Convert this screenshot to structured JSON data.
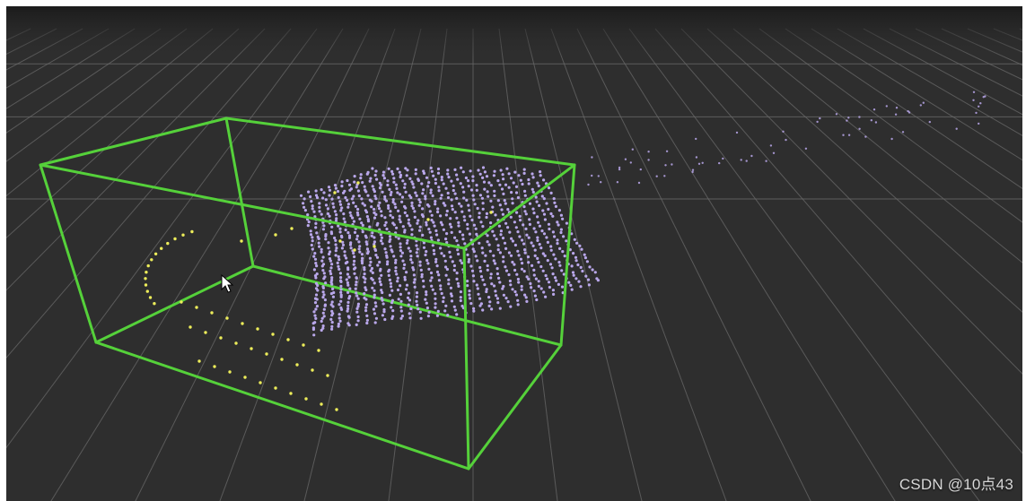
{
  "viewer": {
    "background_color": "#2e2e2e",
    "grid_color": "#6a6a6a",
    "bounding_box_color": "#55d13a",
    "object_points_color": "#b9a7ea",
    "ground_points_color": "#eded5a",
    "cursor_icon": "arrow-cursor-icon"
  },
  "watermark": "CSDN @10点43"
}
